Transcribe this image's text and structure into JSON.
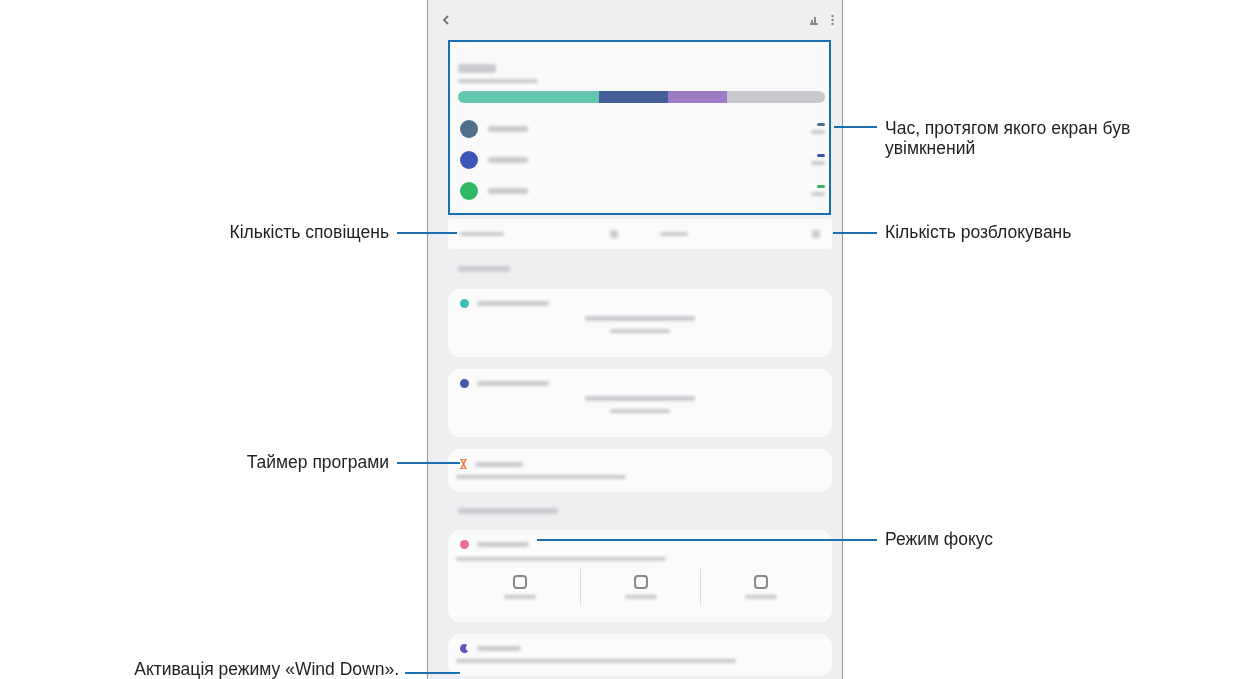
{
  "usage_bar": {
    "segments": [
      {
        "color": "#62c6b1"
      },
      {
        "color": "#445e9a"
      },
      {
        "color": "#9b7cc4"
      },
      {
        "color": "#c8c9cc"
      }
    ]
  },
  "apps": [
    {
      "color": "#4f6e8c"
    },
    {
      "color": "#3e55b5"
    },
    {
      "color": "#2fb866"
    }
  ],
  "goal_cards": [
    {
      "color": "#3fc1b0"
    },
    {
      "color": "#4656a8"
    }
  ],
  "callouts": [
    {
      "text": "Час, протягом якого екран був увімкнений"
    },
    {
      "text": "Кількість сповіщень"
    },
    {
      "text": "Кількість розблокувань"
    },
    {
      "text": "Таймер програми"
    },
    {
      "text": "Режим фокус"
    },
    {
      "text": "Активація режиму «Wind Down»."
    }
  ]
}
